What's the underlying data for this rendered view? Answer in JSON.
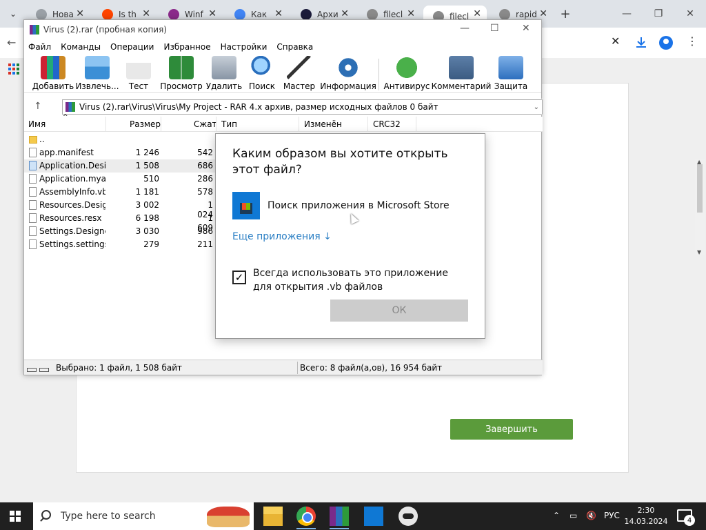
{
  "browser": {
    "tabs": [
      {
        "label": "Нова",
        "favicon": "chrome-icon",
        "color": "#9aa0a6"
      },
      {
        "label": "Is th",
        "favicon": "reddit-icon",
        "color": "#ff4500"
      },
      {
        "label": "Winf",
        "favicon": "winrar-icon",
        "color": "#8b2a8a"
      },
      {
        "label": "Как",
        "favicon": "google-icon",
        "color": "#4285f4"
      },
      {
        "label": "Архи",
        "favicon": "moon-icon",
        "color": "#1b1b3a"
      },
      {
        "label": "filecl",
        "favicon": "globe-icon",
        "color": "#8a8a8a"
      },
      {
        "label": "filecl",
        "favicon": "globe-icon",
        "color": "#8a8a8a"
      },
      {
        "label": "rapid",
        "favicon": "globe-icon",
        "color": "#8a8a8a"
      }
    ],
    "finish_button": "Завершить"
  },
  "winrar": {
    "title": "Virus (2).rar (пробная копия)",
    "menu": [
      "Файл",
      "Команды",
      "Операции",
      "Избранное",
      "Настройки",
      "Справка"
    ],
    "toolbar": [
      {
        "label": "Добавить",
        "icon": "books-icon"
      },
      {
        "label": "Извлечь...",
        "icon": "folder-extract-icon"
      },
      {
        "label": "Тест",
        "icon": "clipboard-test-icon"
      },
      {
        "label": "Просмотр",
        "icon": "book-view-icon"
      },
      {
        "label": "Удалить",
        "icon": "trash-icon"
      },
      {
        "label": "Поиск",
        "icon": "magnifier-icon"
      },
      {
        "label": "Мастер",
        "icon": "wand-icon"
      },
      {
        "label": "Информация",
        "icon": "info-icon"
      },
      {
        "label": "Антивирус",
        "icon": "antivirus-bug-icon"
      },
      {
        "label": "Комментарий",
        "icon": "comment-icon"
      },
      {
        "label": "Защита",
        "icon": "shield-icon"
      }
    ],
    "path": "Virus (2).rar\\Virus\\Virus\\My Project - RAR 4.x архив, размер исходных файлов 0 байт",
    "columns": [
      "Имя",
      "Размер",
      "Сжат",
      "Тип",
      "Изменён",
      "CRC32"
    ],
    "files": [
      {
        "name": "..",
        "size": "",
        "packed": "",
        "folder": true
      },
      {
        "name": "app.manifest",
        "size": "1 246",
        "packed": "542"
      },
      {
        "name": "Application.Desi...",
        "size": "1 508",
        "packed": "686",
        "selected": true
      },
      {
        "name": "Application.mya...",
        "size": "510",
        "packed": "286"
      },
      {
        "name": "AssemblyInfo.vb",
        "size": "1 181",
        "packed": "578"
      },
      {
        "name": "Resources.Desig...",
        "size": "3 002",
        "packed": "1 024"
      },
      {
        "name": "Resources.resx",
        "size": "6 198",
        "packed": "1 609"
      },
      {
        "name": "Settings.Designe...",
        "size": "3 030",
        "packed": "986"
      },
      {
        "name": "Settings.settings",
        "size": "279",
        "packed": "211"
      }
    ],
    "status_selected": "Выбрано: 1 файл, 1 508 байт",
    "status_total": "Всего: 8 файл(а,ов), 16 954 байт"
  },
  "dialog": {
    "title": "Каким образом вы хотите открыть этот файл?",
    "app_option": "Поиск приложения в Microsoft Store",
    "more_apps": "Еще приложения ↓",
    "always_use": "Всегда использовать это приложение для открытия .vb файлов",
    "always_checked": true,
    "ok": "ОК"
  },
  "taskbar": {
    "search_placeholder": "Type here to search",
    "language": "РУС",
    "time": "2:30",
    "date": "14.03.2024",
    "notifications": "4"
  }
}
